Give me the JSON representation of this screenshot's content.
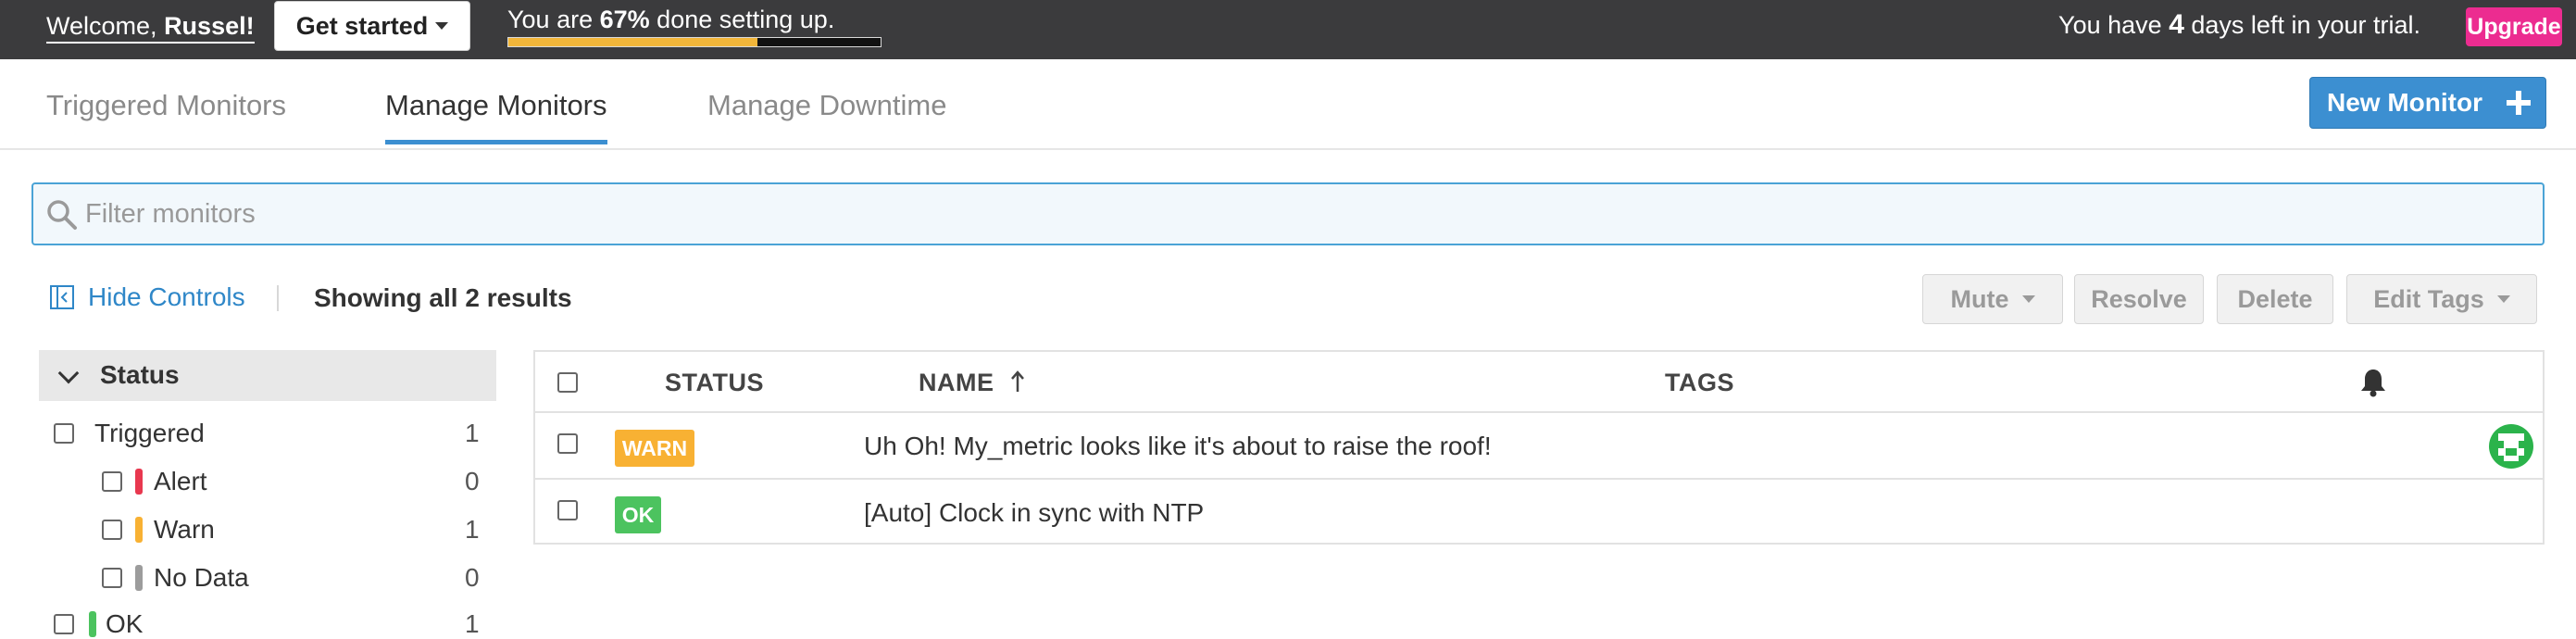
{
  "topbar": {
    "welcome_prefix": "Welcome,",
    "user_name": "Russel!",
    "get_started_label": "Get started",
    "progress_prefix": "You are",
    "progress_percent_label": "67%",
    "progress_suffix": "done setting up.",
    "progress_fraction": 0.67,
    "trial_prefix": "You have",
    "trial_days": "4",
    "trial_suffix": "days left in your trial.",
    "upgrade_label": "Upgrade"
  },
  "tabs": [
    {
      "label": "Triggered Monitors",
      "active": false
    },
    {
      "label": "Manage Monitors",
      "active": true
    },
    {
      "label": "Manage Downtime",
      "active": false
    }
  ],
  "new_monitor_label": "New Monitor",
  "search": {
    "placeholder": "Filter monitors",
    "value": ""
  },
  "controls": {
    "hide_controls_label": "Hide Controls",
    "results_label": "Showing all 2 results",
    "mute_label": "Mute",
    "resolve_label": "Resolve",
    "delete_label": "Delete",
    "edit_tags_label": "Edit Tags"
  },
  "sidebar": {
    "section_title": "Status",
    "filters": [
      {
        "label": "Triggered",
        "count": "1",
        "color": ""
      },
      {
        "label": "Alert",
        "count": "0",
        "color": "#e8384f"
      },
      {
        "label": "Warn",
        "count": "1",
        "color": "#f8b133"
      },
      {
        "label": "No Data",
        "count": "0",
        "color": "#9c9c9c"
      },
      {
        "label": "OK",
        "count": "1",
        "color": "#4cc35f"
      }
    ]
  },
  "table": {
    "columns": [
      "STATUS",
      "NAME",
      "TAGS"
    ],
    "name_sort_icon": "sort-ascending-arrow-icon",
    "notify_icon": "bell-icon",
    "rows": [
      {
        "status": "WARN",
        "status_color": "#f8b133",
        "name": "Uh Oh! My_metric looks like it's about to raise the roof!",
        "has_avatar": true
      },
      {
        "status": "OK",
        "status_color": "#4cc35f",
        "name": "[Auto] Clock in sync with NTP",
        "has_avatar": false
      }
    ]
  },
  "colors": {
    "accent": "#3c8fd1",
    "upgrade": "#ec2c90",
    "topbar": "#3b3b3d",
    "progress": "#f2b63a"
  }
}
